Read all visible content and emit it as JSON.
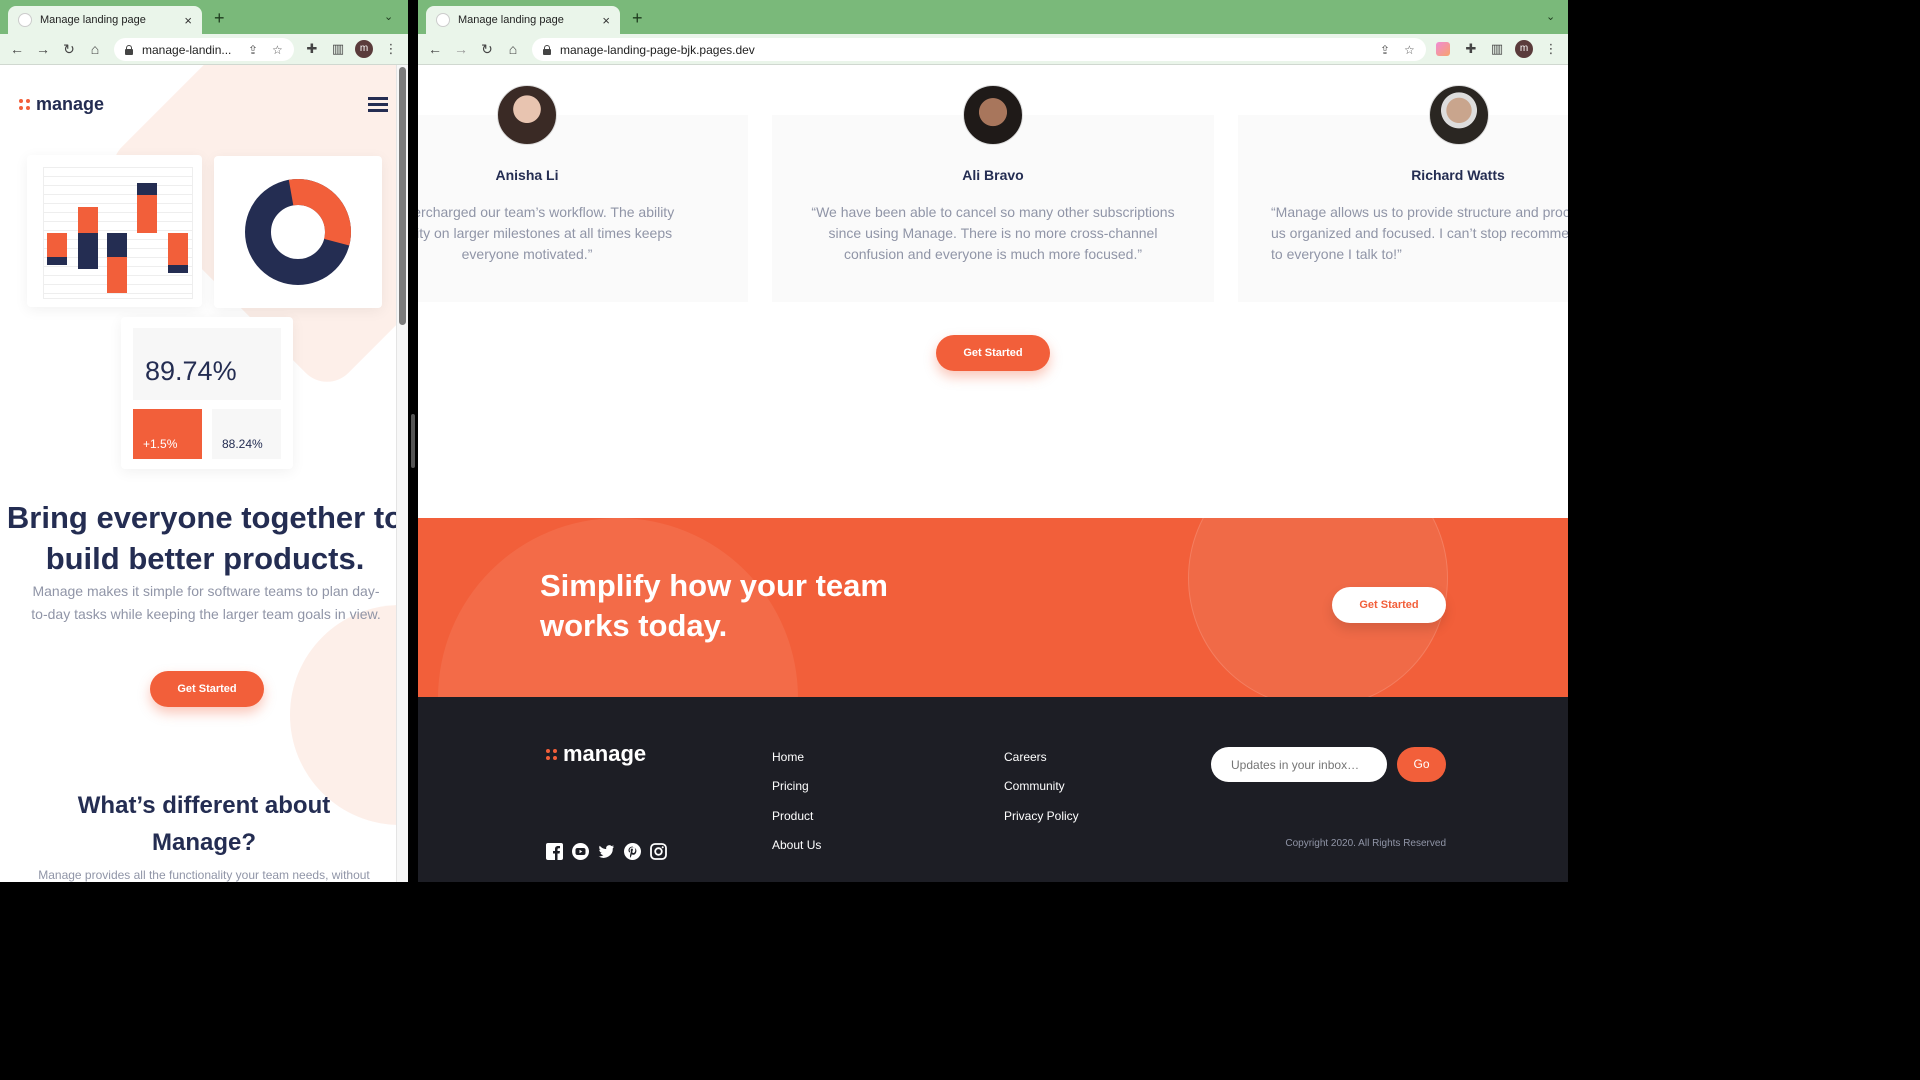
{
  "left_window": {
    "tab": {
      "title": "Manage landing page",
      "close": "×",
      "new_tab": "+",
      "tab_menu": "⌄"
    },
    "toolbar": {
      "back": "←",
      "forward": "→",
      "reload": "↻",
      "home": "⌂",
      "url": "manage-landin..."
    },
    "page": {
      "logo_text": "manage",
      "stats": {
        "big": "89.74%",
        "change": "+1.5%",
        "secondary": "88.24%"
      },
      "hero": {
        "title": "Bring everyone together to build better products.",
        "description": "Manage makes it simple for software teams to plan day-to-day tasks while keeping the larger team goals in view.",
        "cta": "Get Started"
      },
      "section": {
        "title": "What’s different about Manage?",
        "description": "Manage provides all the functionality your team needs, without"
      }
    }
  },
  "right_window": {
    "tab": {
      "title": "Manage landing page",
      "close": "×",
      "new_tab": "+",
      "tab_menu": "⌄"
    },
    "toolbar": {
      "back": "←",
      "forward": "→",
      "reload": "↻",
      "home": "⌂",
      "url": "manage-landing-page-bjk.pages.dev",
      "profile": "m"
    },
    "page": {
      "testimonials": [
        {
          "name": "Anisha Li",
          "quote": "s supercharged our team’s workflow. The ability\nvisibility on larger milestones at all times keeps\neveryone motivated.”"
        },
        {
          "name": "Ali Bravo",
          "quote": "“We have been able to cancel so many other subscriptions\nsince using Manage. There is no more cross-channel\nconfusion and everyone is much more focused.”"
        },
        {
          "name": "Richard Watts",
          "quote": "“Manage allows us to provide structure and proc\nus organized and focused. I can’t stop recomme\nto everyone I talk to!”"
        }
      ],
      "testimonials_cta": "Get Started",
      "cta_banner": {
        "title": "Simplify how your team works today.",
        "button": "Get Started"
      },
      "footer": {
        "logo_text": "manage",
        "links_col1": [
          "Home",
          "Pricing",
          "Product",
          "About Us"
        ],
        "links_col2": [
          "Careers",
          "Community",
          "Privacy Policy"
        ],
        "newsletter_placeholder": "Updates in your inbox…",
        "newsletter_button": "Go",
        "copyright": "Copyright 2020. All Rights Reserved",
        "social": [
          "facebook-icon",
          "youtube-icon",
          "twitter-icon",
          "pinterest-icon",
          "instagram-icon"
        ]
      }
    }
  },
  "profile_initial": "m",
  "colors": {
    "accent": "#f25f3a",
    "navy": "#242d52",
    "tabbar": "#7ab97a",
    "footer": "#1d1e25"
  }
}
